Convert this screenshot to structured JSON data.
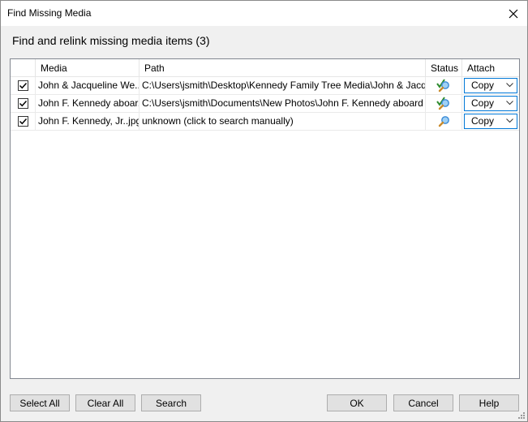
{
  "window": {
    "title": "Find Missing Media",
    "close_icon": "close-icon"
  },
  "heading": "Find and relink missing media items (3)",
  "columns": {
    "media": "Media",
    "path": "Path",
    "status": "Status",
    "attach": "Attach"
  },
  "rows": [
    {
      "checked": true,
      "media": "John & Jacqueline We...",
      "path": "C:\\Users\\jsmith\\Desktop\\Kennedy Family Tree Media\\John & Jacqueli...",
      "status_icon": "found-magnifier-check-icon",
      "attach": "Copy"
    },
    {
      "checked": true,
      "media": "John F. Kennedy aboar...",
      "path": "C:\\Users\\jsmith\\Documents\\New Photos\\John F. Kennedy aboard the...",
      "status_icon": "found-magnifier-check-icon",
      "attach": "Copy"
    },
    {
      "checked": true,
      "media": "John F. Kennedy, Jr..jpg",
      "path": "unknown (click to search manually)",
      "status_icon": "magnifier-icon",
      "attach": "Copy"
    }
  ],
  "buttons": {
    "select_all": "Select All",
    "clear_all": "Clear All",
    "search": "Search",
    "ok": "OK",
    "cancel": "Cancel",
    "help": "Help"
  },
  "colors": {
    "accent_border": "#0078d7",
    "check_green": "#2e8b2e",
    "magnifier_blue": "#3a8ad6"
  }
}
